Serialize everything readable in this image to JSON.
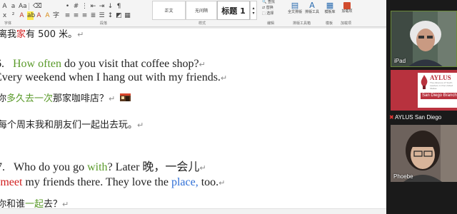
{
  "ribbon": {
    "group_labels": [
      "字体",
      "段落",
      "样式",
      "编辑",
      "排版工具箱",
      "模板",
      "加载项"
    ],
    "styles": {
      "normal": "正文",
      "no_spacing": "无间隔",
      "heading1": "标题 1"
    },
    "tools": {
      "fullwidth": "全文排版",
      "toolbox": "排版工具",
      "template": "模板库",
      "addin": "加载项"
    },
    "edit_items": [
      "查找",
      "替换",
      "选择"
    ]
  },
  "document": {
    "lines": [
      {
        "parts": [
          {
            "t": "离我",
            "c": ""
          },
          {
            "t": "家",
            "c": "r"
          },
          {
            "t": "有 500 米。",
            "c": ""
          }
        ],
        "mark": "↵"
      },
      {
        "num": "6.",
        "parts": [
          {
            "t": "How often",
            "c": "g"
          },
          {
            "t": " do you visit that coffee shop?",
            "c": ""
          }
        ],
        "mark": "↵"
      },
      {
        "parts": [
          {
            "t": "Every weekend when I hang out with my friends.",
            "c": ""
          }
        ],
        "mark": "↵"
      },
      {
        "parts": [
          {
            "t": "你",
            "c": ""
          },
          {
            "t": "多久去一次",
            "c": "g"
          },
          {
            "t": "那家咖啡店？",
            "c": ""
          }
        ],
        "mark": "↵"
      },
      {
        "parts": [
          {
            "t": "每个周末我和朋友们一起出去玩。",
            "c": ""
          }
        ],
        "mark": "↵"
      },
      {
        "num": "7.",
        "parts": [
          {
            "t": "Who do you go ",
            "c": ""
          },
          {
            "t": "with",
            "c": "g"
          },
          {
            "t": "? Later 晚，一会儿",
            "c": ""
          }
        ],
        "mark": "↵"
      },
      {
        "parts": [
          {
            "t": "I ",
            "c": ""
          },
          {
            "t": "meet",
            "c": "r"
          },
          {
            "t": " my friends there. They love the ",
            "c": ""
          },
          {
            "t": "place,",
            "c": "b"
          },
          {
            "t": " too.",
            "c": ""
          }
        ],
        "mark": "↵"
      },
      {
        "parts": [
          {
            "t": "你和谁",
            "c": ""
          },
          {
            "t": "一起",
            "c": "g"
          },
          {
            "t": "去？",
            "c": ""
          }
        ],
        "mark": "↵"
      }
    ]
  },
  "participants": {
    "ipad": {
      "name": "iPad"
    },
    "aylus": {
      "name": "AYLUS San Diego",
      "logo_title": "AYLUS",
      "logo_sub": "The Alliance of Youth Leaders in the United States",
      "strip": "San Diego Branch"
    },
    "phoebe": {
      "name": "Phoebe"
    }
  },
  "colors": {
    "green": "#5a9a2a",
    "red": "#d21f1f",
    "blue": "#2f6fd6",
    "aylus_red": "#b8323e"
  }
}
